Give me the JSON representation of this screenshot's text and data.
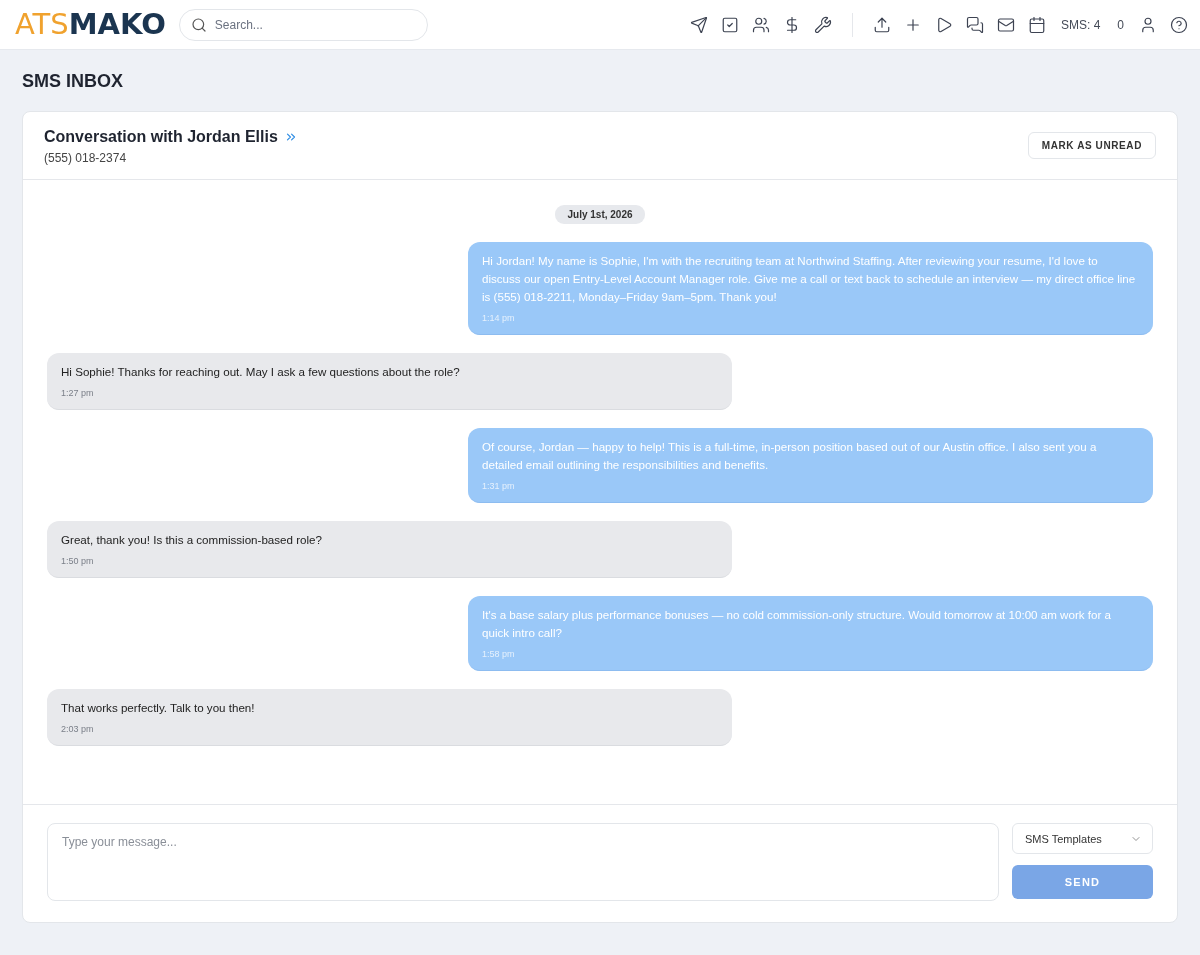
{
  "header": {
    "logo": {
      "prefix": "ATS",
      "name": "MAKO"
    },
    "search": {
      "placeholder": "Search..."
    },
    "sms_count": "SMS: 4",
    "counter": "0"
  },
  "page": {
    "title": "SMS INBOX"
  },
  "conversation": {
    "title": "Conversation with Jordan Ellis",
    "phone": "(555) 018-2374",
    "mark_button": "MARK AS UNREAD",
    "date": "July 1st, 2026",
    "messages": [
      {
        "kind": "outgoing",
        "text": "Hi Jordan! My name is Sophie, I'm with the recruiting team at Northwind Staffing. After reviewing your resume, I'd love to discuss our open Entry-Level Account Manager role. Give me a call or text back to schedule an interview — my direct office line is (555) 018-2211, Monday–Friday 9am–5pm. Thank you!",
        "time": "1:14 pm"
      },
      {
        "kind": "incoming",
        "text": "Hi Sophie! Thanks for reaching out. May I ask a few questions about the role?",
        "time": "1:27 pm"
      },
      {
        "kind": "outgoing",
        "text": "Of course, Jordan — happy to help! This is a full-time, in-person position based out of our Austin office. I also sent you a detailed email outlining the responsibilities and benefits.",
        "time": "1:31 pm"
      },
      {
        "kind": "incoming",
        "text": "Great, thank you! Is this a commission-based role?",
        "time": "1:50 pm"
      },
      {
        "kind": "outgoing",
        "text": "It's a base salary plus performance bonuses — no cold commission-only structure. Would tomorrow at 10:00 am work for a quick intro call?",
        "time": "1:58 pm"
      },
      {
        "kind": "incoming",
        "text": "That works perfectly. Talk to you then!",
        "time": "2:03 pm"
      }
    ]
  },
  "composer": {
    "placeholder": "Type your message...",
    "templates": "SMS Templates",
    "send": "SEND"
  }
}
